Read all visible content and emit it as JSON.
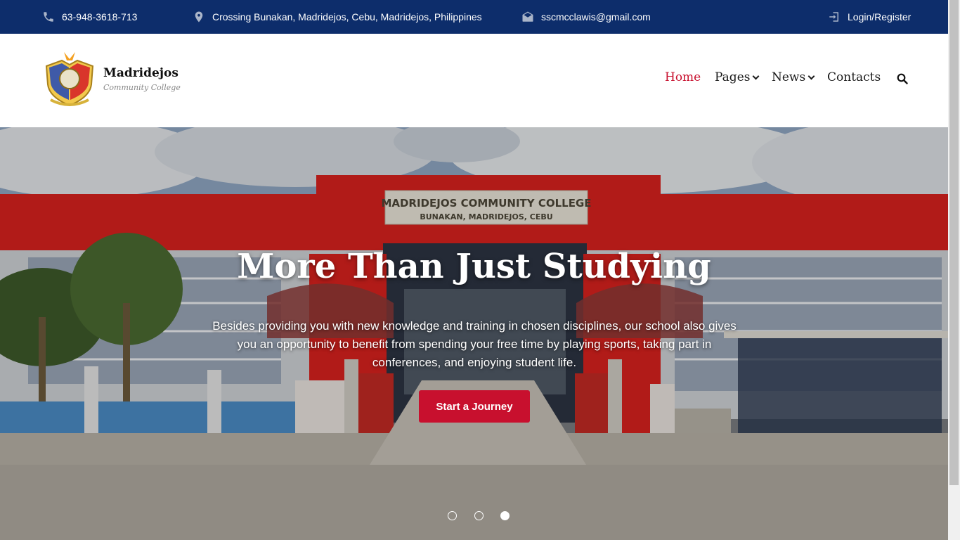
{
  "topbar": {
    "phone": "63-948-3618-713",
    "address": "Crossing Bunakan, Madridejos, Cebu, Madridejos, Philippines",
    "email": "sscmcclawis@gmail.com",
    "login": "Login/Register",
    "icons": [
      "phone-icon",
      "map-pin-icon",
      "envelope-icon",
      "login-icon"
    ]
  },
  "header": {
    "brand_name": "Madridejos",
    "brand_sub": "Community College"
  },
  "nav": {
    "items": [
      {
        "label": "Home",
        "active": true,
        "dropdown": false
      },
      {
        "label": "Pages",
        "active": false,
        "dropdown": true
      },
      {
        "label": "News",
        "active": false,
        "dropdown": true
      },
      {
        "label": "Contacts",
        "active": false,
        "dropdown": false
      }
    ]
  },
  "hero": {
    "title": "More Than Just Studying",
    "description": "Besides providing you with new knowledge and training in chosen disciplines, our school also gives you an opportunity to benefit from spending your free time by playing sports, taking part in conferences, and enjoying student life.",
    "cta": "Start a Journey",
    "building_sign_line1": "MADRIDEJOS COMMUNITY COLLEGE",
    "building_sign_line2": "BUNAKAN, MADRIDEJOS, CEBU",
    "slides": 3,
    "active_slide": 3
  },
  "colors": {
    "topbar_bg": "#0d2d6b",
    "accent": "#c8102e",
    "building_red": "#d8211e"
  }
}
